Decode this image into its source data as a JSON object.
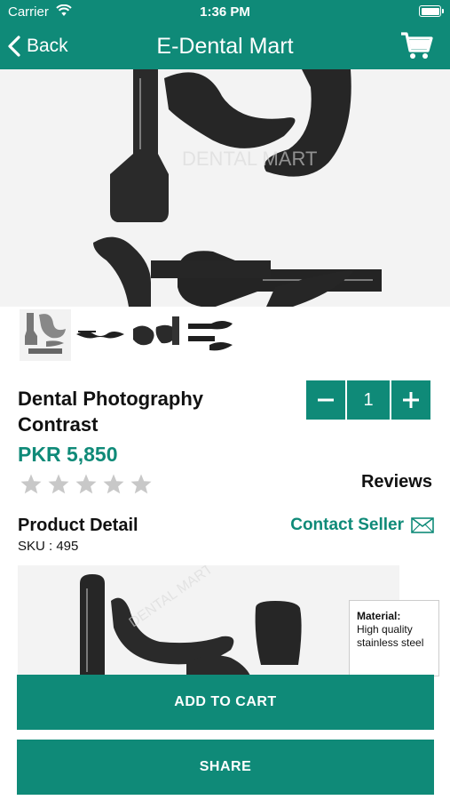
{
  "status_bar": {
    "carrier": "Carrier",
    "time": "1:36 PM"
  },
  "nav": {
    "back_label": "Back",
    "title": "E-Dental Mart"
  },
  "product": {
    "title": "Dental Photography Contrast",
    "price": "PKR 5,850",
    "rating": 0,
    "rating_max": 5,
    "reviews_label": "Reviews",
    "quantity": "1"
  },
  "detail": {
    "heading": "Product Detail",
    "sku": "SKU : 495",
    "contact_label": "Contact Seller",
    "material_title": "Material:",
    "material_value": "High quality stainless steel"
  },
  "buttons": {
    "add_to_cart": "ADD TO CART",
    "share": "SHARE"
  },
  "colors": {
    "accent": "#0f8a78",
    "star_inactive": "#c8c8c8"
  },
  "icons": [
    "wifi-icon",
    "battery-icon",
    "chevron-left-icon",
    "cart-icon",
    "minus-icon",
    "plus-icon",
    "star-icon",
    "mail-icon"
  ]
}
